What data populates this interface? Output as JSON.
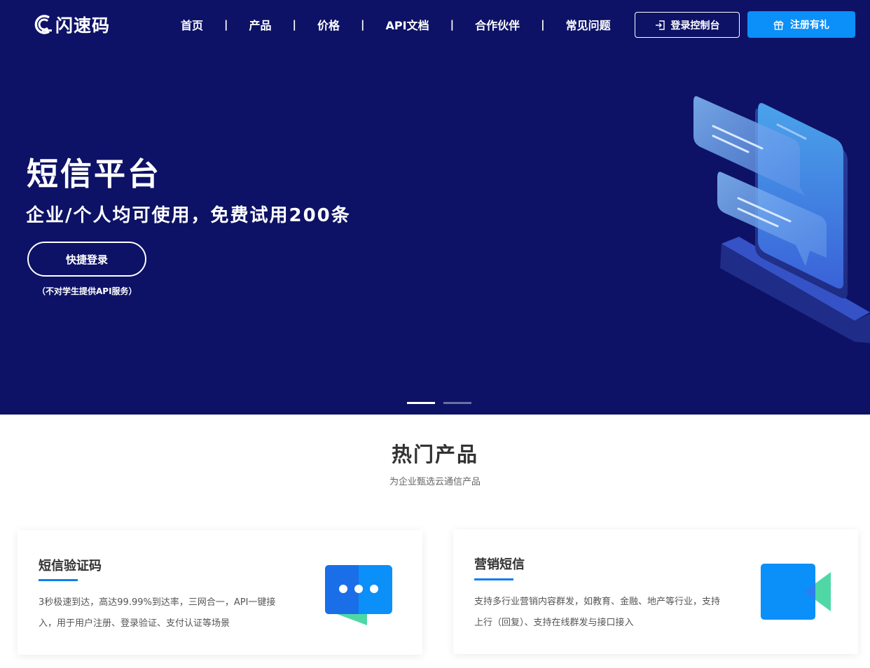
{
  "header": {
    "logo_text": "闪速码",
    "nav": [
      "首页",
      "产品",
      "价格",
      "API文档",
      "合作伙伴",
      "常见问题"
    ],
    "nav_separator": "|",
    "console_button": "登录控制台",
    "register_button": "注册有礼"
  },
  "hero": {
    "title": "短信平台",
    "subtitle": "企业/个人均可使用，免费试用200条",
    "quick_login": "快捷登录",
    "note": "（不对学生提供API服务）",
    "carousel_active_slide": 1,
    "carousel_slide_count": 2
  },
  "products": {
    "title": "热门产品",
    "subtitle": "为企业甄选云通信产品",
    "items": [
      {
        "title": "短信验证码",
        "desc": "3秒极速到达，高达99.99%到达率，三网合一，API一键接入，用于用户注册、登录验证、支付认证等场景",
        "icon": "chat-bubble-icon"
      },
      {
        "title": "营销短信",
        "desc": "支持多行业营销内容群发，如教育、金融、地产等行业，支持上行（回复）、支持在线群发与接口接入",
        "icon": "video-camera-icon"
      }
    ]
  },
  "colors": {
    "hero_bg": "#0d1266",
    "accent_blue": "#0b8ff8",
    "card_underline": "#0b7ef2",
    "icon_green": "#4fd8a6"
  }
}
